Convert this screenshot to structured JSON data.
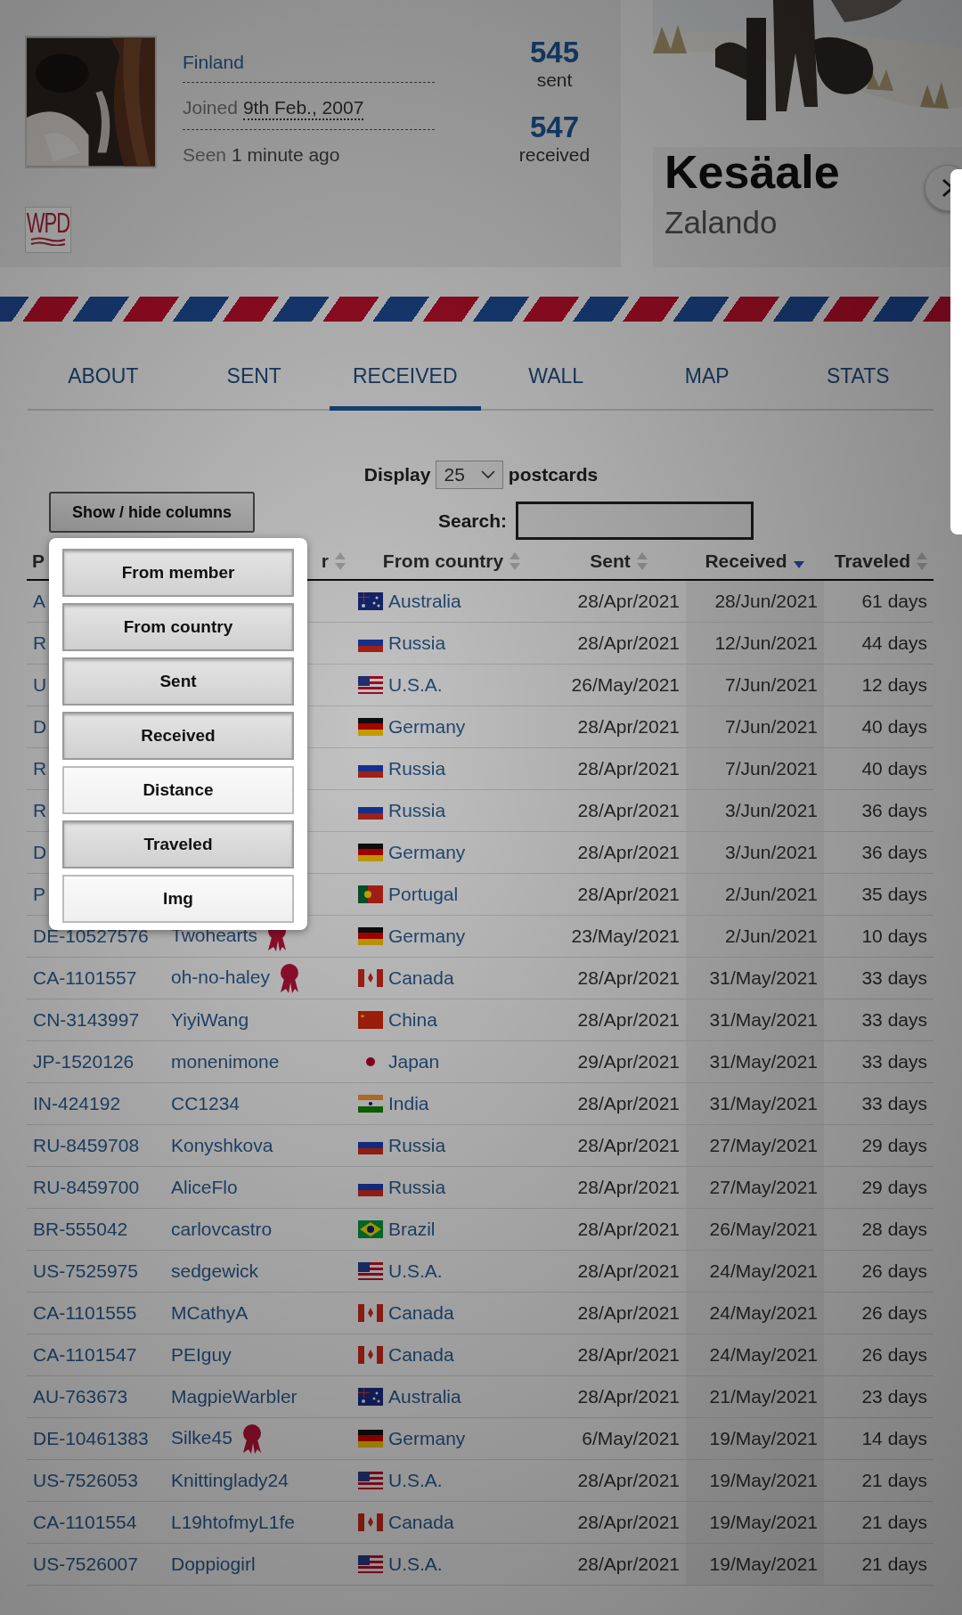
{
  "profile": {
    "country": "Finland",
    "joined_label": "Joined",
    "joined_date": "9th Feb., 2007",
    "seen_label": "Seen",
    "seen_value": "1 minute ago",
    "logo": "WPD",
    "stats": [
      {
        "value": "545",
        "label": "sent"
      },
      {
        "value": "547",
        "label": "received"
      }
    ]
  },
  "ad": {
    "title": "Kesäale",
    "brand": "Zalando"
  },
  "tabs": [
    {
      "label": "ABOUT",
      "selected": false
    },
    {
      "label": "SENT",
      "selected": false
    },
    {
      "label": "RECEIVED",
      "selected": true
    },
    {
      "label": "WALL",
      "selected": false
    },
    {
      "label": "MAP",
      "selected": false
    },
    {
      "label": "STATS",
      "selected": false
    }
  ],
  "display": {
    "label": "Display",
    "value": "25",
    "suffix": "postcards"
  },
  "columns_button": "Show / hide columns",
  "search": {
    "label": "Search:"
  },
  "table": {
    "columns": [
      {
        "label": "P"
      },
      {
        "label": "r",
        "sorted": false
      },
      {
        "label": "From country",
        "sorted": false
      },
      {
        "label": "Sent",
        "sorted": false
      },
      {
        "label": "Received",
        "sorted": true
      },
      {
        "label": "Traveled",
        "sorted": false
      }
    ],
    "rows": [
      {
        "postcard": "A",
        "country": "Australia",
        "kind": "au",
        "sent": "28/Apr/2021",
        "received": "28/Jun/2021",
        "traveled": "61 days",
        "ribbon": false
      },
      {
        "postcard": "R",
        "country": "Russia",
        "kind": "ru",
        "sent": "28/Apr/2021",
        "received": "12/Jun/2021",
        "traveled": "44 days",
        "ribbon": false
      },
      {
        "postcard": "U",
        "country": "U.S.A.",
        "kind": "us",
        "sent": "26/May/2021",
        "received": "7/Jun/2021",
        "traveled": "12 days",
        "ribbon": false
      },
      {
        "postcard": "D",
        "country": "Germany",
        "kind": "de",
        "sent": "28/Apr/2021",
        "received": "7/Jun/2021",
        "traveled": "40 days",
        "ribbon": false
      },
      {
        "postcard": "R",
        "country": "Russia",
        "kind": "ru",
        "sent": "28/Apr/2021",
        "received": "7/Jun/2021",
        "traveled": "40 days",
        "ribbon": false
      },
      {
        "postcard": "R",
        "country": "Russia",
        "kind": "ru",
        "sent": "28/Apr/2021",
        "received": "3/Jun/2021",
        "traveled": "36 days",
        "ribbon": false
      },
      {
        "postcard": "D",
        "country": "Germany",
        "kind": "de",
        "sent": "28/Apr/2021",
        "received": "3/Jun/2021",
        "traveled": "36 days",
        "ribbon": false
      },
      {
        "postcard": "P",
        "country": "Portugal",
        "kind": "pt",
        "sent": "28/Apr/2021",
        "received": "2/Jun/2021",
        "traveled": "35 days",
        "ribbon": false
      },
      {
        "postcard": "DE-10527576",
        "member": "Twohearts",
        "country": "Germany",
        "kind": "de",
        "sent": "23/May/2021",
        "received": "2/Jun/2021",
        "traveled": "10 days",
        "ribbon": true
      },
      {
        "postcard": "CA-1101557",
        "member": "oh-no-haley",
        "country": "Canada",
        "kind": "ca",
        "sent": "28/Apr/2021",
        "received": "31/May/2021",
        "traveled": "33 days",
        "ribbon": true
      },
      {
        "postcard": "CN-3143997",
        "member": "YiyiWang",
        "country": "China",
        "kind": "cn",
        "sent": "28/Apr/2021",
        "received": "31/May/2021",
        "traveled": "33 days",
        "ribbon": false
      },
      {
        "postcard": "JP-1520126",
        "member": "monenimone",
        "country": "Japan",
        "kind": "jp",
        "sent": "29/Apr/2021",
        "received": "31/May/2021",
        "traveled": "33 days",
        "ribbon": false
      },
      {
        "postcard": "IN-424192",
        "member": "CC1234",
        "country": "India",
        "kind": "in",
        "sent": "28/Apr/2021",
        "received": "31/May/2021",
        "traveled": "33 days",
        "ribbon": false
      },
      {
        "postcard": "RU-8459708",
        "member": "Konyshkova",
        "country": "Russia",
        "kind": "ru",
        "sent": "28/Apr/2021",
        "received": "27/May/2021",
        "traveled": "29 days",
        "ribbon": false
      },
      {
        "postcard": "RU-8459700",
        "member": "AliceFlo",
        "country": "Russia",
        "kind": "ru",
        "sent": "28/Apr/2021",
        "received": "27/May/2021",
        "traveled": "29 days",
        "ribbon": false
      },
      {
        "postcard": "BR-555042",
        "member": "carlovcastro",
        "country": "Brazil",
        "kind": "br",
        "sent": "28/Apr/2021",
        "received": "26/May/2021",
        "traveled": "28 days",
        "ribbon": false
      },
      {
        "postcard": "US-7525975",
        "member": "sedgewick",
        "country": "U.S.A.",
        "kind": "us",
        "sent": "28/Apr/2021",
        "received": "24/May/2021",
        "traveled": "26 days",
        "ribbon": false
      },
      {
        "postcard": "CA-1101555",
        "member": "MCathyA",
        "country": "Canada",
        "kind": "ca",
        "sent": "28/Apr/2021",
        "received": "24/May/2021",
        "traveled": "26 days",
        "ribbon": false
      },
      {
        "postcard": "CA-1101547",
        "member": "PEIguy",
        "country": "Canada",
        "kind": "ca",
        "sent": "28/Apr/2021",
        "received": "24/May/2021",
        "traveled": "26 days",
        "ribbon": false
      },
      {
        "postcard": "AU-763673",
        "member": "MagpieWarbler",
        "country": "Australia",
        "kind": "au",
        "sent": "28/Apr/2021",
        "received": "21/May/2021",
        "traveled": "23 days",
        "ribbon": false
      },
      {
        "postcard": "DE-10461383",
        "member": "Silke45",
        "country": "Germany",
        "kind": "de",
        "sent": "6/May/2021",
        "received": "19/May/2021",
        "traveled": "14 days",
        "ribbon": true
      },
      {
        "postcard": "US-7526053",
        "member": "Knittinglady24",
        "country": "U.S.A.",
        "kind": "us",
        "sent": "28/Apr/2021",
        "received": "19/May/2021",
        "traveled": "21 days",
        "ribbon": false
      },
      {
        "postcard": "CA-1101554",
        "member": "L19htofmyL1fe",
        "country": "Canada",
        "kind": "ca",
        "sent": "28/Apr/2021",
        "received": "19/May/2021",
        "traveled": "21 days",
        "ribbon": false
      },
      {
        "postcard": "US-7526007",
        "member": "Doppiogirl",
        "country": "U.S.A.",
        "kind": "us",
        "sent": "28/Apr/2021",
        "received": "19/May/2021",
        "traveled": "21 days",
        "ribbon": false
      }
    ]
  },
  "column_menu": {
    "options": [
      {
        "label": "From member",
        "selected": true
      },
      {
        "label": "From country",
        "selected": true
      },
      {
        "label": "Sent",
        "selected": true
      },
      {
        "label": "Received",
        "selected": true
      },
      {
        "label": "Distance",
        "selected": false
      },
      {
        "label": "Traveled",
        "selected": true
      },
      {
        "label": "Img",
        "selected": false
      }
    ]
  }
}
